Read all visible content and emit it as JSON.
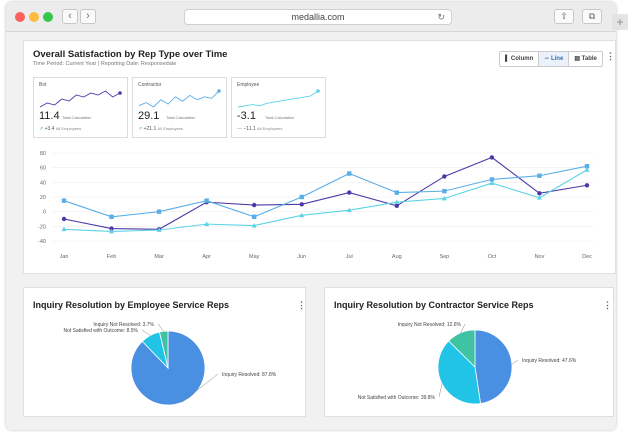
{
  "browser": {
    "url": "medallia.com",
    "back_icon": "chevron-left-icon",
    "forward_icon": "chevron-right-icon",
    "reload_icon": "reload-icon",
    "share_icon": "share-icon",
    "tabs_icon": "tabs-icon",
    "new_tab_icon": "plus-icon"
  },
  "main": {
    "title": "Overall Satisfaction by Rep Type over Time",
    "subtitle": "Time Period: Current Year | Reporting Date: Responsedate",
    "toggle": [
      {
        "label": "Column",
        "icon": "column-chart-icon",
        "active": false
      },
      {
        "label": "Line",
        "icon": "line-chart-icon",
        "active": true
      },
      {
        "label": "Table",
        "icon": "table-icon",
        "active": false
      }
    ],
    "summary_cards": [
      {
        "label": "Bot",
        "value": "11.4",
        "value_caption": "Total Calculation",
        "compare": "+3.4",
        "compare_caption": "All Employees",
        "color": "#4a3aa8",
        "spark": [
          20,
          22,
          21,
          24,
          23,
          26,
          25,
          27,
          26,
          28,
          25,
          27
        ]
      },
      {
        "label": "Contractor",
        "value": "29.1",
        "value_caption": "Total Calculation",
        "compare": "+21.1",
        "compare_caption": "All Employees",
        "color": "#5aaee8",
        "spark": [
          18,
          20,
          17,
          22,
          19,
          24,
          21,
          25,
          22,
          24,
          23,
          28
        ]
      },
      {
        "label": "Employee",
        "value": "-3.1",
        "value_caption": "Total Calculation",
        "compare": "−11.1",
        "compare_caption": "All Employees",
        "color": "#5cd3e6",
        "spark": [
          15,
          16,
          17,
          16,
          18,
          19,
          20,
          21,
          22,
          23,
          24,
          28
        ]
      }
    ]
  },
  "chart_data": {
    "type": "line",
    "categories": [
      "Jan",
      "Feb",
      "Mar",
      "Apr",
      "May",
      "Jun",
      "Jul",
      "Aug",
      "Sep",
      "Oct",
      "Nov",
      "Dec"
    ],
    "ylim": [
      -40,
      80
    ],
    "yticks": [
      80,
      60,
      40,
      20,
      0,
      -20,
      -40
    ],
    "series": [
      {
        "color": "#4a3aa8",
        "marker": "circle",
        "values": [
          -10,
          -23,
          -24,
          13,
          9,
          10,
          26,
          8,
          48,
          74,
          25,
          36
        ]
      },
      {
        "color": "#5aaee8",
        "marker": "square",
        "values": [
          15,
          -7,
          0,
          15,
          -7,
          20,
          52,
          26,
          28,
          44,
          49,
          62
        ]
      },
      {
        "color": "#5cd3e6",
        "marker": "triangle",
        "values": [
          -24,
          -27,
          -25,
          -17,
          -19,
          -5,
          2,
          13,
          18,
          39,
          19,
          57
        ]
      }
    ]
  },
  "pie_employee": {
    "title": "Inquiry Resolution by Employee Service Reps",
    "slices": [
      {
        "label": "Inquiry Resolved: 87.8%",
        "value": 87.8,
        "color": "#4a90e2"
      },
      {
        "label": "Not Satisfied with Outcome: 8.5%",
        "value": 8.5,
        "color": "#21c4e6"
      },
      {
        "label": "Inquiry Not Resolved: 3.7%",
        "value": 3.7,
        "color": "#3fc3a3"
      }
    ]
  },
  "pie_contractor": {
    "title": "Inquiry Resolution by Contractor Service Reps",
    "slices": [
      {
        "label": "Inquiry Resolved: 47.6%",
        "value": 47.6,
        "color": "#4a90e2"
      },
      {
        "label": "Not Satisfied with Outcome: 39.8%",
        "value": 39.8,
        "color": "#21c4e6"
      },
      {
        "label": "Inquiry Not Resolved: 12.6%",
        "value": 12.6,
        "color": "#3fc3a3"
      }
    ]
  }
}
